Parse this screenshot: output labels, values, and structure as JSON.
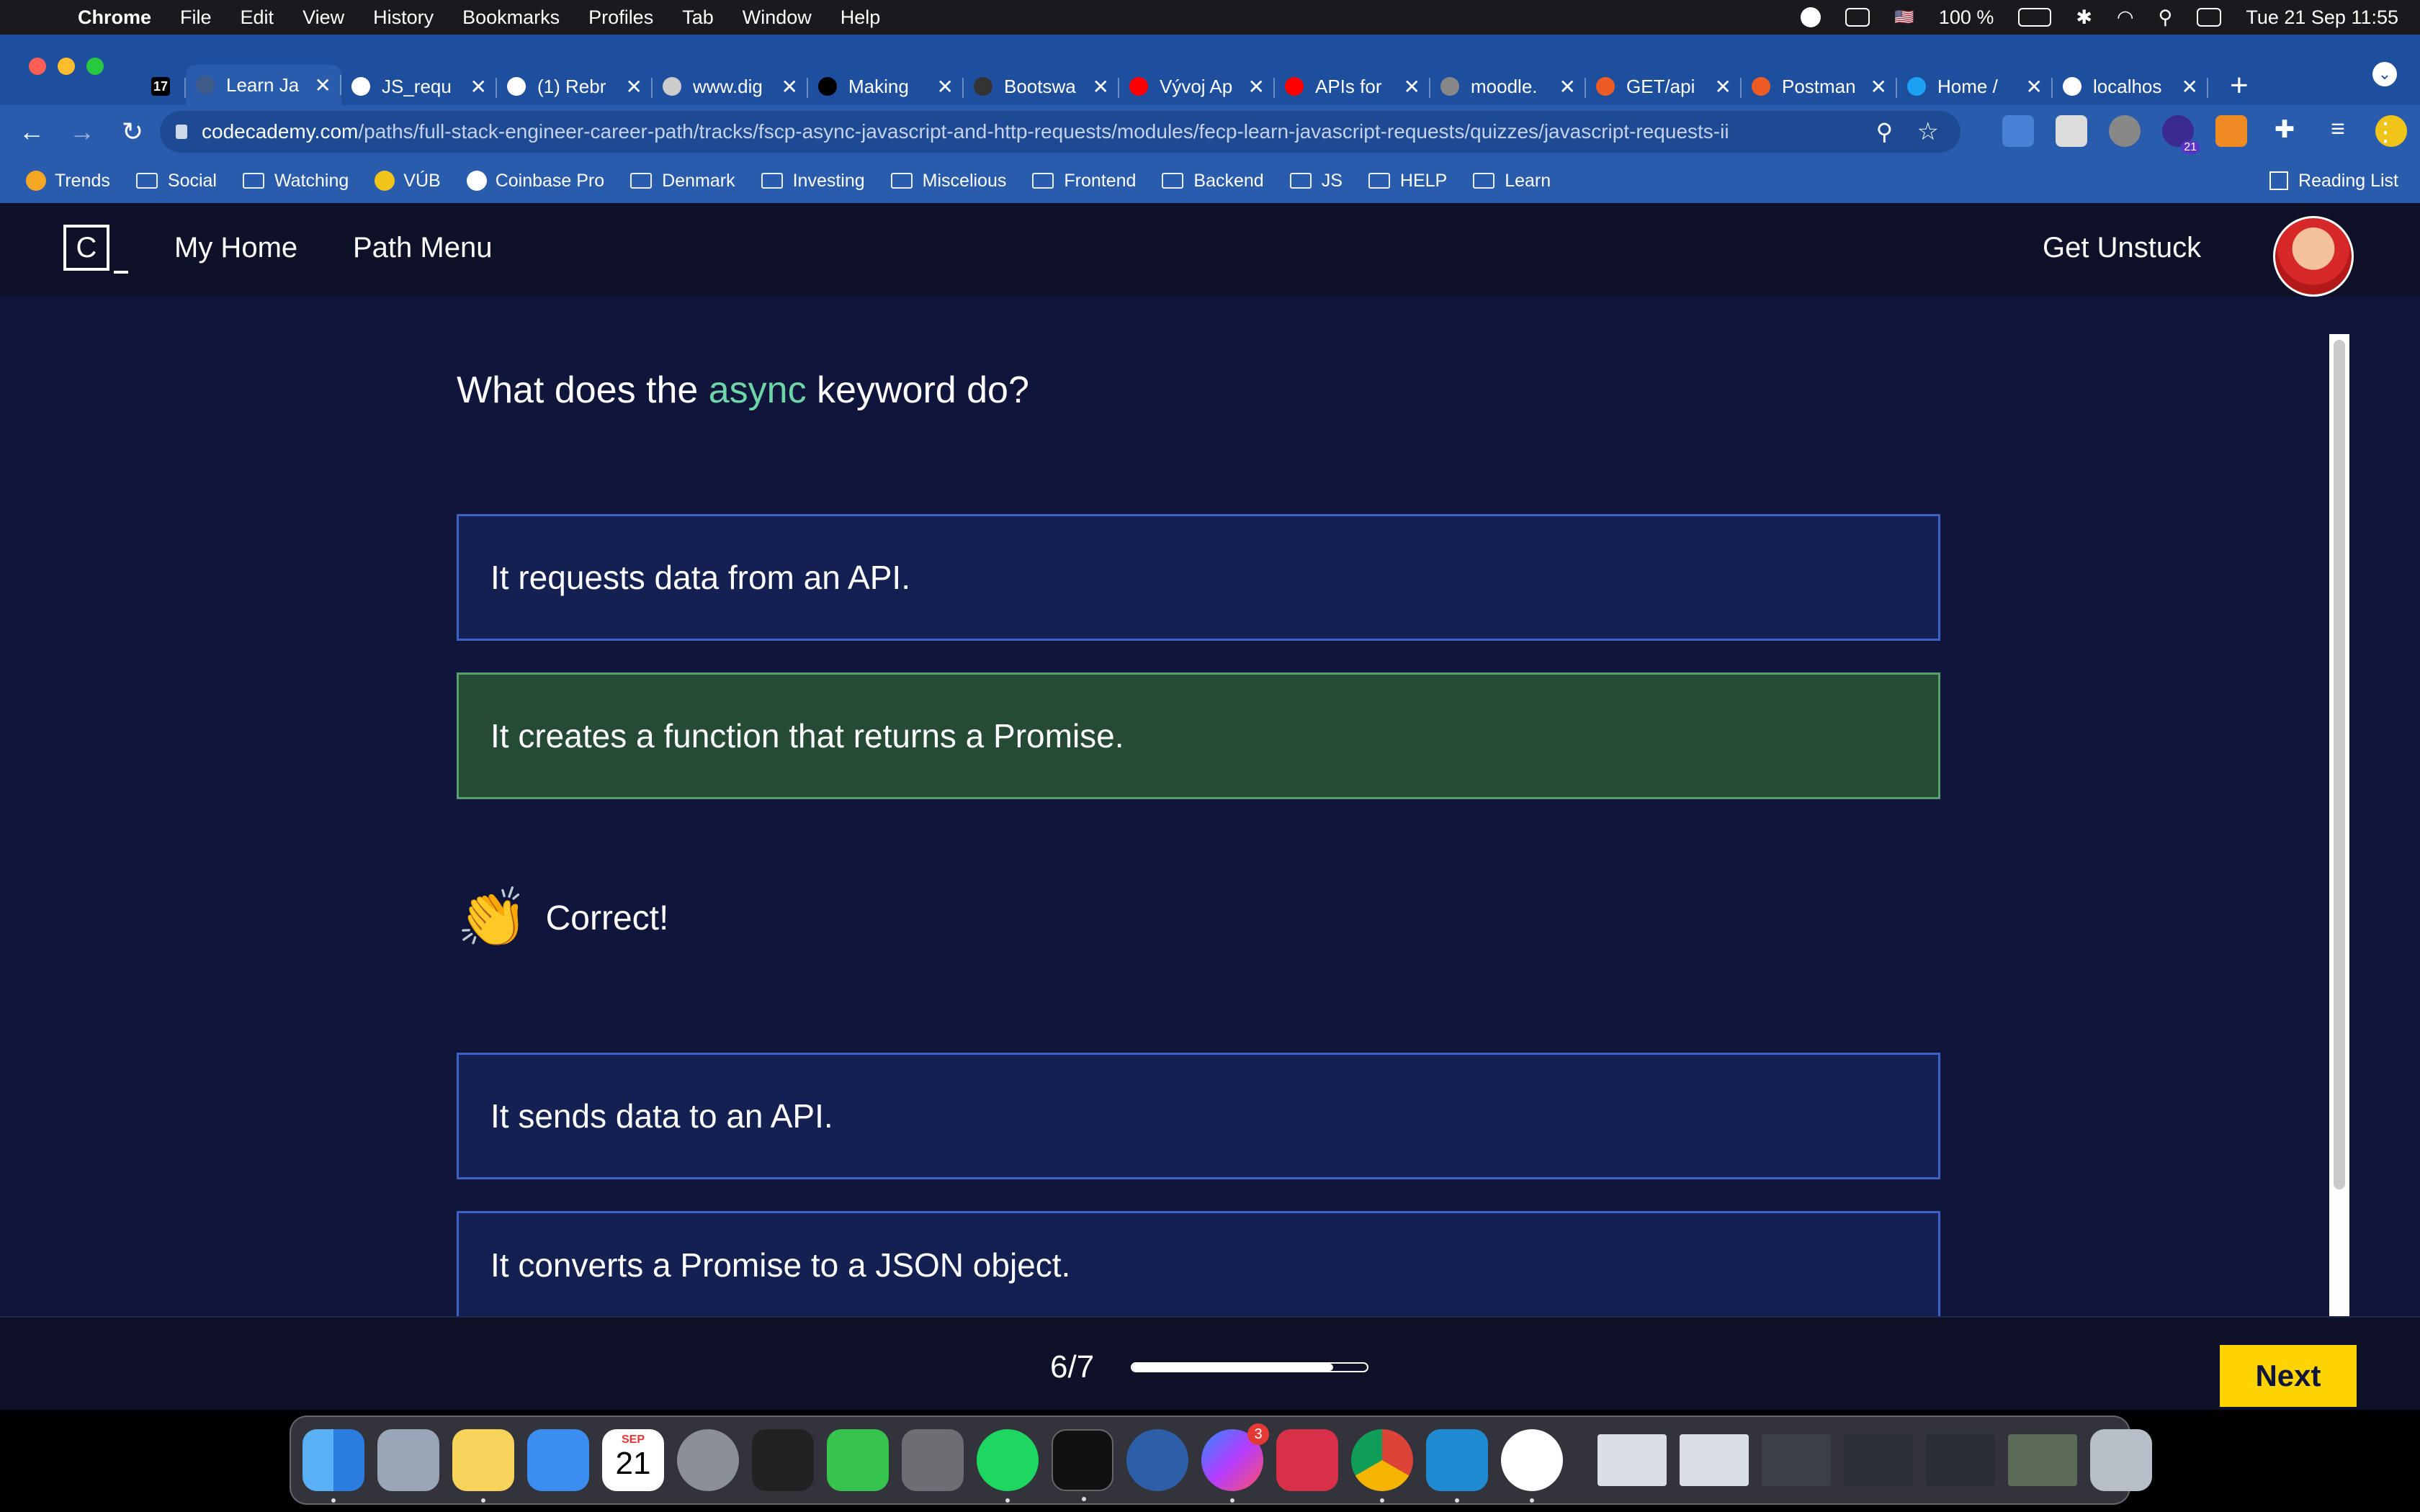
{
  "menubar": {
    "items": [
      "Chrome",
      "File",
      "Edit",
      "View",
      "History",
      "Bookmarks",
      "Profiles",
      "Tab",
      "Window",
      "Help"
    ],
    "battery": "100 %",
    "datetime": "Tue 21 Sep  11:55"
  },
  "tabs": [
    {
      "title": "",
      "favicon_color": "#000000",
      "favicon_text": "17"
    },
    {
      "title": "Learn Ja",
      "favicon_color": "#3d5a8a",
      "active": true
    },
    {
      "title": "JS_requ",
      "favicon_color": "#ffffff"
    },
    {
      "title": "(1) Rebr",
      "favicon_color": "#ffffff"
    },
    {
      "title": "www.dig",
      "favicon_color": "#cccccc"
    },
    {
      "title": "Making",
      "favicon_color": "#000000"
    },
    {
      "title": "Bootswa",
      "favicon_color": "#333333"
    },
    {
      "title": "Vývoj Ap",
      "favicon_color": "#ff0000"
    },
    {
      "title": "APIs for",
      "favicon_color": "#ff0000"
    },
    {
      "title": "moodle.",
      "favicon_color": "#888888"
    },
    {
      "title": "GET/api",
      "favicon_color": "#ef5b25"
    },
    {
      "title": "Postman",
      "favicon_color": "#ef5b25"
    },
    {
      "title": "Home /",
      "favicon_color": "#1da1f2"
    },
    {
      "title": "localhos",
      "favicon_color": "#ffffff"
    }
  ],
  "address": {
    "host": "codecademy.com",
    "path": "/paths/full-stack-engineer-career-path/tracks/fscp-async-javascript-and-http-requests/modules/fecp-learn-javascript-requests/quizzes/javascript-requests-ii"
  },
  "extension_badge": "21",
  "bookmarks": [
    {
      "label": "Trends",
      "type": "icon"
    },
    {
      "label": "Social",
      "type": "folder"
    },
    {
      "label": "Watching",
      "type": "folder"
    },
    {
      "label": "VÚB",
      "type": "icon"
    },
    {
      "label": "Coinbase Pro",
      "type": "icon"
    },
    {
      "label": "Denmark",
      "type": "folder"
    },
    {
      "label": "Investing",
      "type": "folder"
    },
    {
      "label": "Miscelious",
      "type": "folder"
    },
    {
      "label": "Frontend",
      "type": "folder"
    },
    {
      "label": "Backend",
      "type": "folder"
    },
    {
      "label": "JS",
      "type": "folder"
    },
    {
      "label": "HELP",
      "type": "folder"
    },
    {
      "label": "Learn",
      "type": "folder"
    }
  ],
  "reading_list": "Reading List",
  "header": {
    "logo_text": "C",
    "my_home": "My Home",
    "path_menu": "Path Menu",
    "get_unstuck": "Get Unstuck"
  },
  "quiz": {
    "question_pre": "What does the ",
    "question_keyword": "async",
    "question_post": " keyword do?",
    "answers": [
      "It requests data from an API.",
      "It creates a function that returns a Promise.",
      "It sends data to an API.",
      "It converts a Promise to a JSON object."
    ],
    "feedback_emoji": "👏",
    "feedback_text": "Correct!"
  },
  "footer": {
    "progress_text": "6/7",
    "progress_fraction": 0.857,
    "next_label": "Next"
  },
  "dock": {
    "calendar_month": "SEP",
    "calendar_day": "21",
    "messenger_badge": "3"
  }
}
